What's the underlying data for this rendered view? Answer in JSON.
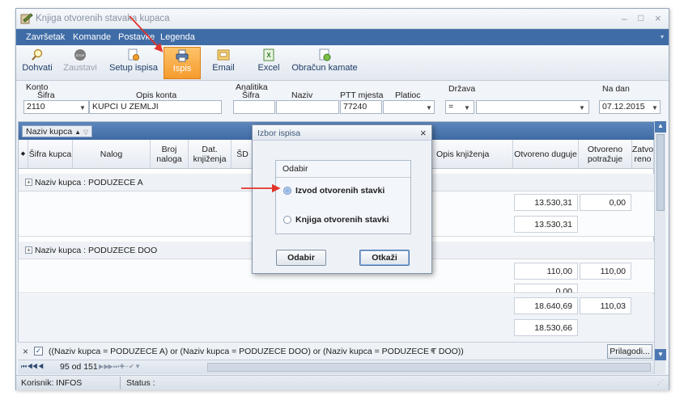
{
  "window": {
    "title": "Knjiga otvorenih stavaka kupaca",
    "controls": [
      "–",
      "□",
      "×"
    ]
  },
  "menu": [
    "Završetak",
    "Komande",
    "Postavke",
    "Legenda"
  ],
  "toolbar": {
    "buttons": [
      {
        "label": "Dohvati",
        "icon": "magnifier-icon",
        "state": "normal"
      },
      {
        "label": "Zaustavi",
        "icon": "stop-icon",
        "state": "disabled"
      },
      {
        "label": "Setup ispisa",
        "icon": "page-setup-icon",
        "state": "normal"
      },
      {
        "label": "Ispis",
        "icon": "printer-icon",
        "state": "active"
      },
      {
        "label": "Email",
        "icon": "email-icon",
        "state": "normal"
      },
      {
        "label": "Excel",
        "icon": "excel-icon",
        "state": "normal"
      },
      {
        "label": "Obračun kamate",
        "icon": "interest-calc-icon",
        "state": "normal"
      }
    ]
  },
  "filters": {
    "konto_label": "Konto",
    "sifra_label": "Šifra",
    "opis_konta_label": "Opis konta",
    "konto_value": "2110",
    "opis_konta_value": "KUPCI U ZEMLJI",
    "analitika_label": "Analitika",
    "analitika_sifra_label": "Šifra",
    "naziv_label": "Naziv",
    "ptt_label": "PTT mjesta",
    "platioc_label": "Platioc",
    "ptt_value": "77240",
    "drzava_label": "Država",
    "drzava_op": "=",
    "na_dan_label": "Na dan",
    "na_dan_value": "07.12.2015"
  },
  "grid": {
    "group_chip": "Naziv kupca",
    "columns": [
      "Šifra kupca",
      "Nalog",
      "Broj naloga",
      "Dat. knjiženja",
      "ŠD",
      "Opis knjiženja",
      "Otvoreno duguje",
      "Otvoreno potražuje",
      "Zatvo reno"
    ],
    "groups": [
      {
        "label": "Naziv kupca : PODUZECE  A"
      },
      {
        "label": "Naziv kupca : PODUZECE DOO"
      }
    ],
    "values": {
      "g1_duguje": "13.530,31",
      "g1_potrazuje": "0,00",
      "g1_total": "13.530,31",
      "g2_duguje": "110,00",
      "g2_potrazuje": "110,00",
      "g2_partial": "0,00",
      "grand_duguje": "18.640,69",
      "grand_potrazuje": "110,03",
      "grand_total": "18.530,66"
    }
  },
  "filter_bar": {
    "close": "×",
    "expression": "((Naziv kupca = PODUZECE  A) or (Naziv kupca = PODUZECE DOO) or (Naziv kupca = PODUZECE T DOO))",
    "customize": "Prilagodi..."
  },
  "navigator": {
    "record_text": "95 od 151"
  },
  "status": {
    "user": "Korisnik: INFOS",
    "status": "Status :"
  },
  "dialog": {
    "title": "Izbor ispisa",
    "close": "×",
    "group_title": "Odabir",
    "option1": "Izvod otvorenih stavki",
    "option2": "Knjiga otvorenih stavki",
    "selected": 1,
    "ok": "Odabir",
    "cancel": "Otkaži"
  },
  "colors": {
    "menubar": "#3f6ca6",
    "accent_orange": "#f59b2e",
    "annotation_red": "#e2332a"
  }
}
